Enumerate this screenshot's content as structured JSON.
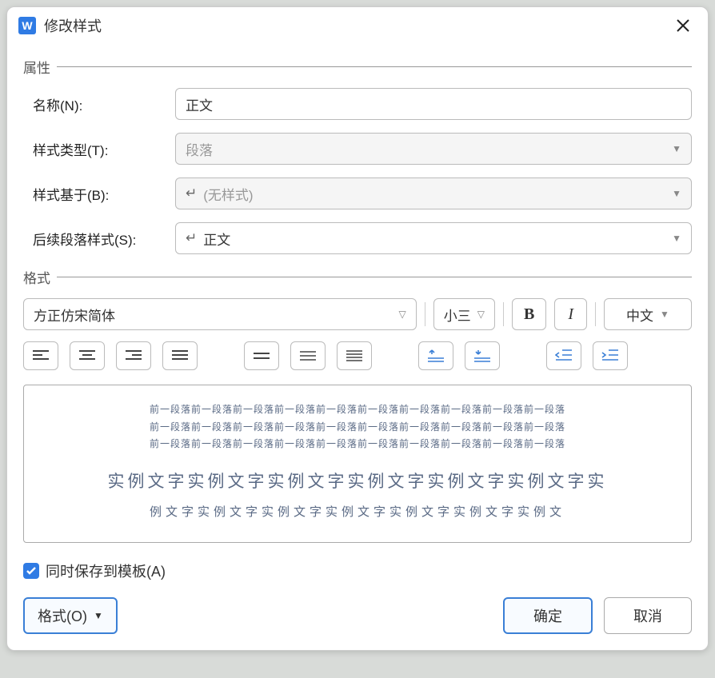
{
  "dialog": {
    "title": "修改样式"
  },
  "groups": {
    "properties": "属性",
    "format": "格式"
  },
  "fields": {
    "name_label": "名称(N):",
    "name_value": "正文",
    "type_label": "样式类型(T):",
    "type_value": "段落",
    "based_label": "样式基于(B):",
    "based_value": "(无样式)",
    "next_label": "后续段落样式(S):",
    "next_value": "正文"
  },
  "toolbar": {
    "font": "方正仿宋简体",
    "size": "小三",
    "bold": "B",
    "italic": "I",
    "lang": "中文"
  },
  "preview": {
    "line1": "前一段落前一段落前一段落前一段落前一段落前一段落前一段落前一段落前一段落前一段落",
    "line2": "前一段落前一段落前一段落前一段落前一段落前一段落前一段落前一段落前一段落前一段落",
    "line3": "前一段落前一段落前一段落前一段落前一段落前一段落前一段落前一段落前一段落前一段落",
    "sample": "实例文字实例文字实例文字实例文字实例文字实例文字实",
    "line4": "例文字实例文字实例文字实例文字实例文字实例文字实例文"
  },
  "checkbox_label": "同时保存到模板(A)",
  "buttons": {
    "format": "格式(O)",
    "ok": "确定",
    "cancel": "取消"
  }
}
